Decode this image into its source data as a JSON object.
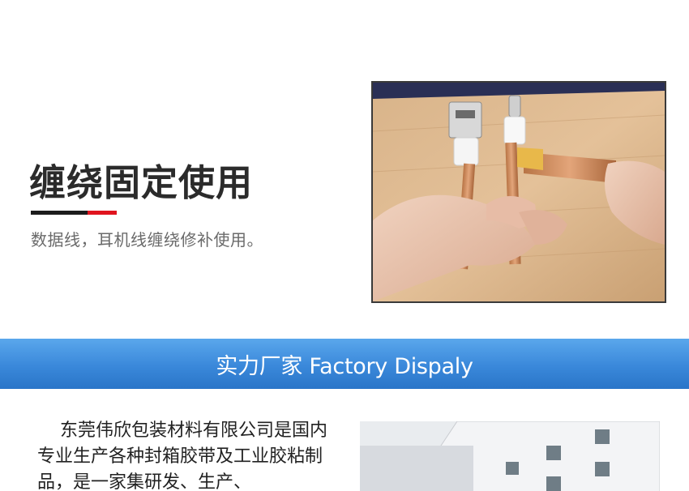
{
  "usage": {
    "title": "缠绕固定使用",
    "description": "数据线，耳机线缠绕修补使用。",
    "underline_colors": [
      "#1c1c1c",
      "#e0141e"
    ]
  },
  "banner": {
    "text": "实力厂家  Factory Dispaly",
    "color": "#3a88da"
  },
  "factory": {
    "intro": "东莞伟欣包装材料有限公司是国内专业生产各种封箱胶带及工业胶粘制品，是一家集研发、生产、"
  }
}
